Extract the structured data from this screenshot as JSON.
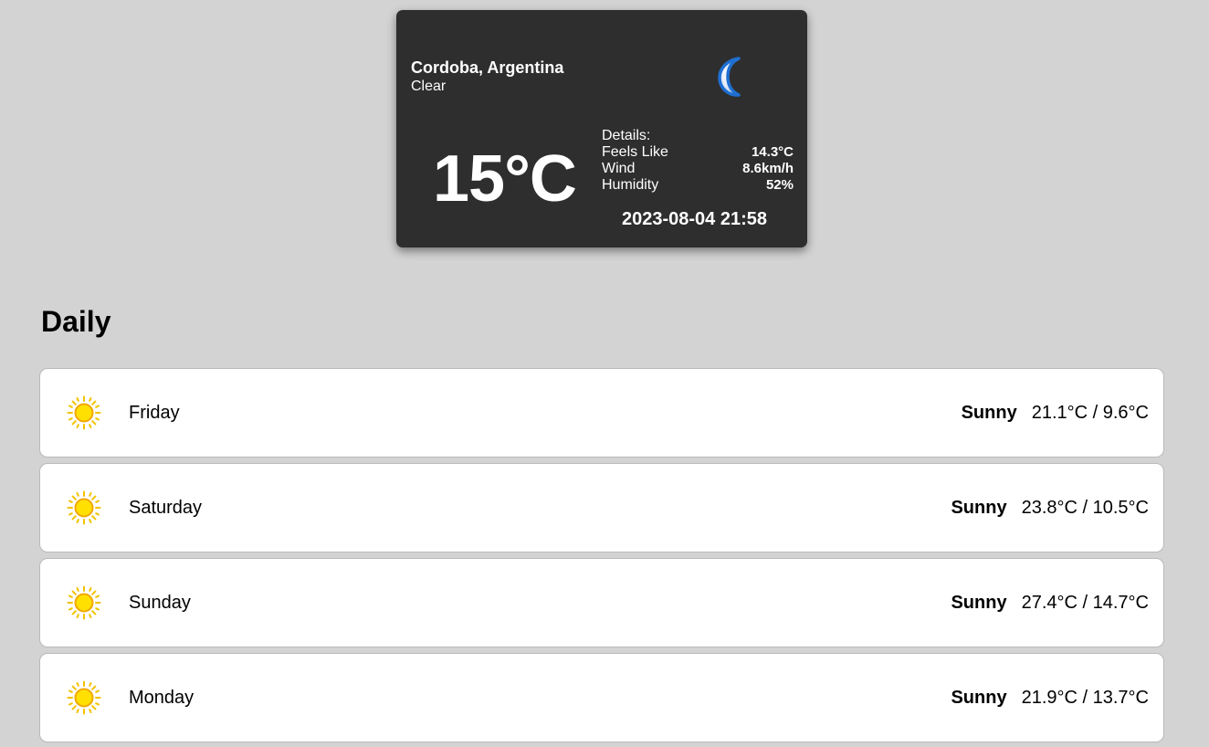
{
  "current": {
    "city": "Cordoba, Argentina",
    "condition": "Clear",
    "condition_icon": "moon-icon",
    "temperature": "15°C",
    "details_label": "Details:",
    "details": [
      {
        "label": "Feels Like",
        "value": "14.3°C"
      },
      {
        "label": "Wind",
        "value": "8.6km/h"
      },
      {
        "label": "Humidity",
        "value": "52%"
      }
    ],
    "datetime": "2023-08-04 21:58"
  },
  "daily": {
    "title": "Daily",
    "days": [
      {
        "day": "Friday",
        "condition": "Sunny",
        "icon": "sun-icon",
        "range": "21.1°C / 9.6°C"
      },
      {
        "day": "Saturday",
        "condition": "Sunny",
        "icon": "sun-icon",
        "range": "23.8°C / 10.5°C"
      },
      {
        "day": "Sunday",
        "condition": "Sunny",
        "icon": "sun-icon",
        "range": "27.4°C / 14.7°C"
      },
      {
        "day": "Monday",
        "condition": "Sunny",
        "icon": "sun-icon",
        "range": "21.9°C / 13.7°C"
      }
    ]
  },
  "colors": {
    "background": "#d3d3d3",
    "card": "#2e2e2e",
    "sun": "#f5d000",
    "moon": "#1f6fd1"
  }
}
